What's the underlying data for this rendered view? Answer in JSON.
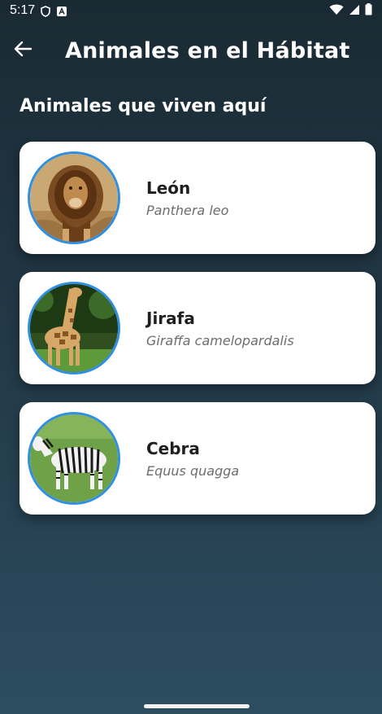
{
  "status_bar": {
    "time": "5:17",
    "icons": [
      "shield-icon",
      "app-notification-icon",
      "wifi-icon",
      "signal-icon",
      "battery-icon"
    ]
  },
  "app_bar": {
    "back_icon": "arrow-left-icon",
    "title": "Animales en el Hábitat"
  },
  "section": {
    "title": "Animales que viven aquí"
  },
  "animals": [
    {
      "name": "León",
      "scientific": "Panthera leo",
      "image": "lion-image"
    },
    {
      "name": "Jirafa",
      "scientific": "Giraffa camelopardalis",
      "image": "giraffe-image"
    },
    {
      "name": "Cebra",
      "scientific": "Equus quagga",
      "image": "zebra-image"
    }
  ],
  "colors": {
    "background_top": "#1a2a33",
    "background_bottom": "#2c4d60",
    "card": "#ffffff",
    "avatar_border": "#2f8fe0",
    "name_text": "#1f1f1f",
    "scientific_text": "#6d6d6d"
  }
}
